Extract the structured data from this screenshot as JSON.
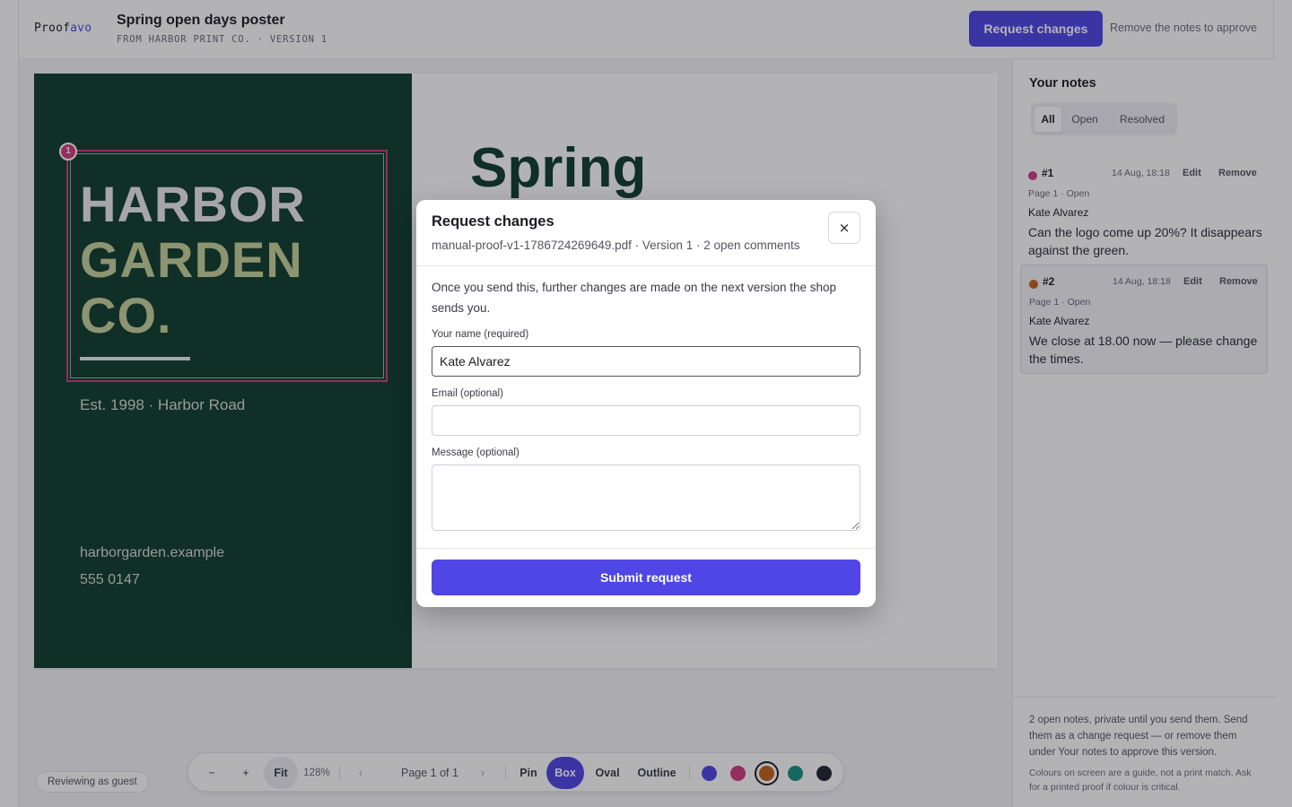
{
  "app": {
    "brand_prefix": "Proof",
    "brand_accent": "avo",
    "accent_color": "#4f46e5"
  },
  "header": {
    "title": "Spring open days poster",
    "subtitle": "FROM HARBOR PRINT CO. · VERSION 1",
    "request_button": "Request changes",
    "approve_hint": "Remove the notes to approve"
  },
  "poster": {
    "line1": "HARBOR",
    "line2": "GARDEN",
    "line3": "CO.",
    "est": "Est. 1998 · Harbor Road",
    "website": "harborgarden.example",
    "phone": "555 0147",
    "headline": "Spring",
    "annotation_pin": "1"
  },
  "toolbar": {
    "zoom_out": "−",
    "zoom_in": "+",
    "fit": "Fit",
    "zoom_level": "128%",
    "prev_page": "‹",
    "page_indicator": "Page 1 of 1",
    "next_page": "›",
    "tools": [
      "Pin",
      "Box",
      "Oval",
      "Outline"
    ],
    "active_tool": "Box",
    "colors": [
      "#4f46e5",
      "#d13b7e",
      "#c2621a",
      "#17917e",
      "#23232d"
    ],
    "selected_color": "#c2621a"
  },
  "guest_badge": "Reviewing as guest",
  "notes_panel": {
    "title": "Your notes",
    "filters": [
      "All",
      "Open",
      "Resolved"
    ],
    "active_filter": "All",
    "notes": [
      {
        "number": "#1",
        "color": "#d13b7e",
        "timestamp": "14 Aug, 18:18",
        "edit_label": "Edit",
        "remove_label": "Remove",
        "meta": "Page 1 · Open",
        "author": "Kate Alvarez",
        "body": "Can the logo come up 20%? It disappears against the green."
      },
      {
        "number": "#2",
        "color": "#c2621a",
        "timestamp": "14 Aug, 18:18",
        "edit_label": "Edit",
        "remove_label": "Remove",
        "meta": "Page 1 · Open",
        "author": "Kate Alvarez",
        "body": "We close at 18.00 now — please change the times."
      }
    ],
    "footer_summary": "2 open notes, private until you send them. Send them as a change request — or remove them under Your notes to approve this version.",
    "footer_disclaimer": "Colours on screen are a guide, not a print match. Ask for a printed proof if colour is critical."
  },
  "modal": {
    "title": "Request changes",
    "subtitle": "manual-proof-v1-1786724269649.pdf · Version 1 · 2 open comments",
    "close_label": "×",
    "intro": "Once you send this, further changes are made on the next version the shop sends you.",
    "name_label": "Your name (required)",
    "name_value": "Kate Alvarez",
    "email_label": "Email (optional)",
    "email_value": "",
    "message_label": "Message (optional)",
    "message_value": "",
    "submit_label": "Submit request"
  }
}
